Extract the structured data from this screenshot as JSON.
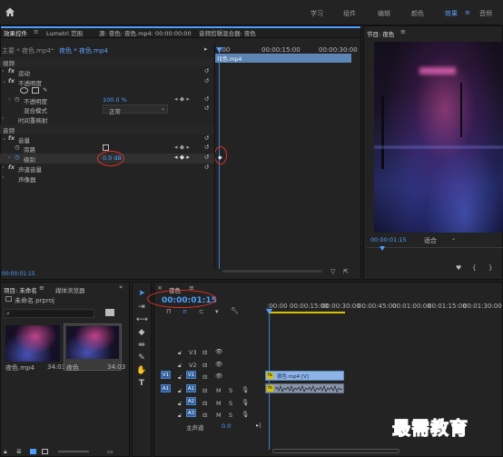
{
  "workspaces": [
    "学习",
    "组件",
    "编辑",
    "颜色",
    "效果",
    "音频"
  ],
  "active_workspace": "效果",
  "effect_controls": {
    "tabs": [
      "效果控件",
      "Lumetri 范围",
      "源: 夜色: 夜色.mp4: 00:00:00:00",
      "音频剪辑混合器: 夜色"
    ],
    "master_label": "主要 * 夜色.mp4",
    "clip_label": "夜色 * 夜色.mp4",
    "ruler_start": ":00",
    "ruler_mid": "00:00:15:00",
    "ruler_end": "00:00:30:00",
    "clip_bar_label": "夜色.mp4",
    "video_header": "视频",
    "motion": "运动",
    "opacity": "不透明度",
    "opacity_prop": "不透明度",
    "opacity_value": "100.0 %",
    "blend_mode_label": "混合模式",
    "blend_mode_value": "正常",
    "time_remap": "时间重映射",
    "audio_header": "音频",
    "volume": "音量",
    "bypass": "旁路",
    "level": "级别",
    "level_value": "0.0 dB",
    "channel_volume": "声道音量",
    "panner": "声像器",
    "timecode": "00:00:01:15"
  },
  "program_monitor": {
    "title": "节目: 夜色",
    "timecode": "00:00:01:15",
    "fit": "适合"
  },
  "project": {
    "tabs": [
      "项目: 未命名",
      "媒体浏览器"
    ],
    "file": "未命名.prproj",
    "items": [
      {
        "name": "夜色.mp4",
        "duration": "34:03"
      },
      {
        "name": "夜色",
        "duration": "34:03"
      }
    ]
  },
  "timeline": {
    "title": "夜色",
    "timecode": "00:00:01:15",
    "ruler": [
      ":00:00",
      "00:00:15:00",
      "00:00:30:00",
      "00:00:45:00",
      "00:01:00:00",
      "00:01:15:00",
      "00:01:30:00"
    ],
    "video_tracks": [
      "V3",
      "V2",
      "V1"
    ],
    "audio_tracks": [
      "A1",
      "A2",
      "A3"
    ],
    "master": "主声道",
    "master_value": "0.0",
    "v1_clip": "夜色.mp4 [V]",
    "src_v": "V1",
    "src_a": "A1"
  },
  "watermark": "最需教育",
  "colors": {
    "accent": "#4d9fff",
    "clip_video": "#8db4e6",
    "annotation": "#e0302a"
  }
}
